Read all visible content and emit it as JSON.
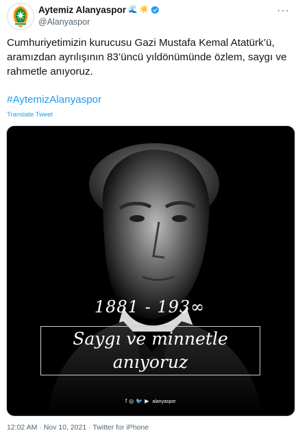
{
  "author": {
    "display_name": "Aytemiz Alanyaspor",
    "handle": "@Alanyaspor",
    "emojis": [
      "🌊",
      "☀️"
    ],
    "verified": true,
    "avatar_icon": "alanyaspor-logo"
  },
  "more_menu": "···",
  "tweet": {
    "text": "Cumhuriyetimizin kurucusu Gazi Mustafa Kemal Atatürk’ü, aramızdan ayrılışının 83’üncü yıldönümünde özlem, saygı ve rahmetle anıyoruz.",
    "hashtag": "#AytemizAlanyaspor",
    "translate": "Translate Tweet"
  },
  "media": {
    "years": "1881 - 193∞",
    "quote_line1": "Saygı ve minnetle",
    "quote_line2": "anıyoruz",
    "social_icons": [
      "facebook-icon",
      "instagram-icon",
      "twitter-icon",
      "youtube-icon"
    ],
    "social_handle": "alanyaspor"
  },
  "meta": {
    "time": "12:02 AM",
    "date": "Nov 10, 2021",
    "source": "Twitter for iPhone",
    "separator": "·"
  },
  "colors": {
    "link": "#1d9bf0",
    "text": "#0f1419",
    "muted": "#536471",
    "brand_green": "#1f8a3b",
    "brand_orange": "#f39200"
  }
}
